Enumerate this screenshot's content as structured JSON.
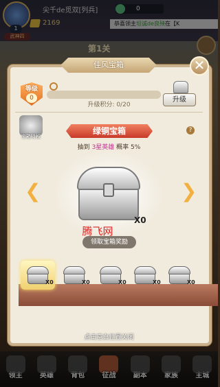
{
  "hud": {
    "player_name": "尖千de觅双[列兵]",
    "level": "1",
    "rank": "武神四",
    "gold": "2169",
    "resource_value": "0",
    "marquee_prefix": "恭喜领主",
    "marquee_highlight": "坦诚de良殃",
    "marquee_suffix": "在【K",
    "stage": "第1关"
  },
  "dialog": {
    "title": "佳风宝箱",
    "close_icon": "✕",
    "level_word": "等级",
    "level_value": "0",
    "progress_fraction": 0.0,
    "upgrade_label": "升级",
    "points_text": "升级积分: 0/20",
    "preview_label": "宝箱特权",
    "help_glyph": "?",
    "chest_name": "绿铜宝箱",
    "odds_prefix": "抽到",
    "odds_highlight": "3星英雄",
    "odds_suffix": "概率 5%",
    "chest_count": "X0",
    "watermark": "腾飞网",
    "hint_pill": "领取宝箱奖励",
    "arrow_left": "❮",
    "arrow_right": "❯",
    "slots": [
      {
        "count": "X0",
        "selected": true
      },
      {
        "count": "X0",
        "selected": false
      },
      {
        "count": "X0",
        "selected": false
      },
      {
        "count": "X0",
        "selected": false
      },
      {
        "count": "X0",
        "selected": false
      }
    ],
    "dismiss_hint": "点击空白位置关闭"
  },
  "nav": [
    {
      "label": "领主",
      "active": false
    },
    {
      "label": "英雄",
      "active": false
    },
    {
      "label": "背包",
      "active": false
    },
    {
      "label": "征战",
      "active": true
    },
    {
      "label": "副本",
      "active": false
    },
    {
      "label": "家族",
      "active": false
    },
    {
      "label": "主城",
      "active": false
    }
  ]
}
